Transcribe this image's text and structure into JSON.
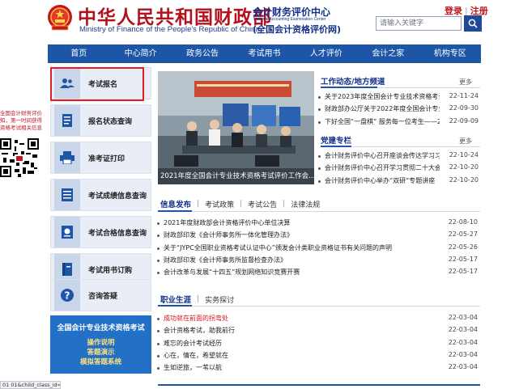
{
  "header": {
    "logo_cn": "中华人民共和国财政部",
    "logo_en": "Ministry of Finance of the People's Republic of China",
    "center_cn": "会计财务评价中心",
    "center_en": "National Accounting Examination Center",
    "center_sub": "(全国会计资格评价网)",
    "login_label": "登录",
    "register_label": "注册",
    "search_placeholder": "请输入关键字",
    "search_icon": "magnifier-icon",
    "brand_red": "#b3111d",
    "brand_blue": "#12308a"
  },
  "nav": {
    "items": [
      "首页",
      "中心简介",
      "政务公告",
      "考试用书",
      "人才评价",
      "会计之家",
      "机构专区"
    ],
    "color": "#1e56a7"
  },
  "sidebar": {
    "items": [
      {
        "label": "考试报名",
        "icon": "users-icon"
      },
      {
        "label": "报名状态查询",
        "icon": "document-icon"
      },
      {
        "label": "准考证打印",
        "icon": "printer-icon"
      },
      {
        "label": "考试成绩信息查询",
        "icon": "report-icon"
      },
      {
        "label": "考试合格信息查询",
        "icon": "certificate-icon"
      },
      {
        "label": "考试用书订购",
        "icon": "book-icon"
      },
      {
        "label": "咨询答疑",
        "icon": "question-icon"
      }
    ],
    "cert": {
      "title": "全国会计专业技术资格考试",
      "links": [
        "操作说明",
        "答题演示",
        "模拟答题系统"
      ]
    }
  },
  "float_left": {
    "lines": [
      "全国会计财务评价",
      "知，第一时间获得",
      "资格考试相关信息"
    ]
  },
  "photo": {
    "caption": "2021年度全国会计专业技术资格考试评价工作会..."
  },
  "work_news": {
    "title": "工作动态/地方频道",
    "more": "更多",
    "items": [
      {
        "title": "关于2023年度全国会计专业技术资格考试考...",
        "date": "22-11-24"
      },
      {
        "title": "财政部办公厅关于2022年度全国会计专业技术...",
        "date": "22-09-30"
      },
      {
        "title": "下好全国“一盘棋” 服务每一位考生——20...",
        "date": "22-09-09"
      }
    ]
  },
  "party_news": {
    "title": "党建专栏",
    "more": "更多",
    "items": [
      {
        "title": "会计财务评价中心召开座谈会传达学习习近...",
        "date": "22-10-24"
      },
      {
        "title": "会计财务评价中心召开学习贯彻二十大会议...",
        "date": "22-10-20"
      },
      {
        "title": "会计财务评价中心举办“双研”专题讲座",
        "date": "22-10-20"
      }
    ]
  },
  "info_tabs": {
    "tabs": [
      "信息发布",
      "考试政策",
      "考试公告",
      "法律法规"
    ],
    "items": [
      {
        "title": "2021年度财政部会计资格评价中心单位决算",
        "date": "22-08-10"
      },
      {
        "title": "财政部印发《会计师事务所一体化管理办法》",
        "date": "22-05-27"
      },
      {
        "title": "关于“JYPC全国职业资格考试认证中心”颁发会计类职业资格证书有关问题的声明",
        "date": "22-05-26"
      },
      {
        "title": "财政部印发《会计师事务所监督检查办法》",
        "date": "22-05-17"
      },
      {
        "title": "会计改革与发展“十四五”规划网络知识竞赛开赛",
        "date": "22-05-17"
      }
    ]
  },
  "career_tabs": {
    "tabs": [
      "职业生涯",
      "实务探讨"
    ],
    "items": [
      {
        "title": "成功就在前面的拐弯处",
        "date": "22-03-04",
        "highlight": true
      },
      {
        "title": "会计资格考试，助我前行",
        "date": "22-03-04",
        "highlight": false
      },
      {
        "title": "难忘的会计考试经历",
        "date": "22-03-04",
        "highlight": false
      },
      {
        "title": "心在，情在，希望就在",
        "date": "22-03-04",
        "highlight": false
      },
      {
        "title": "生如逆旅，一苇以航",
        "date": "22-03-04",
        "highlight": false
      }
    ]
  },
  "status_bar": {
    "text": "01 01&child_class_id="
  }
}
